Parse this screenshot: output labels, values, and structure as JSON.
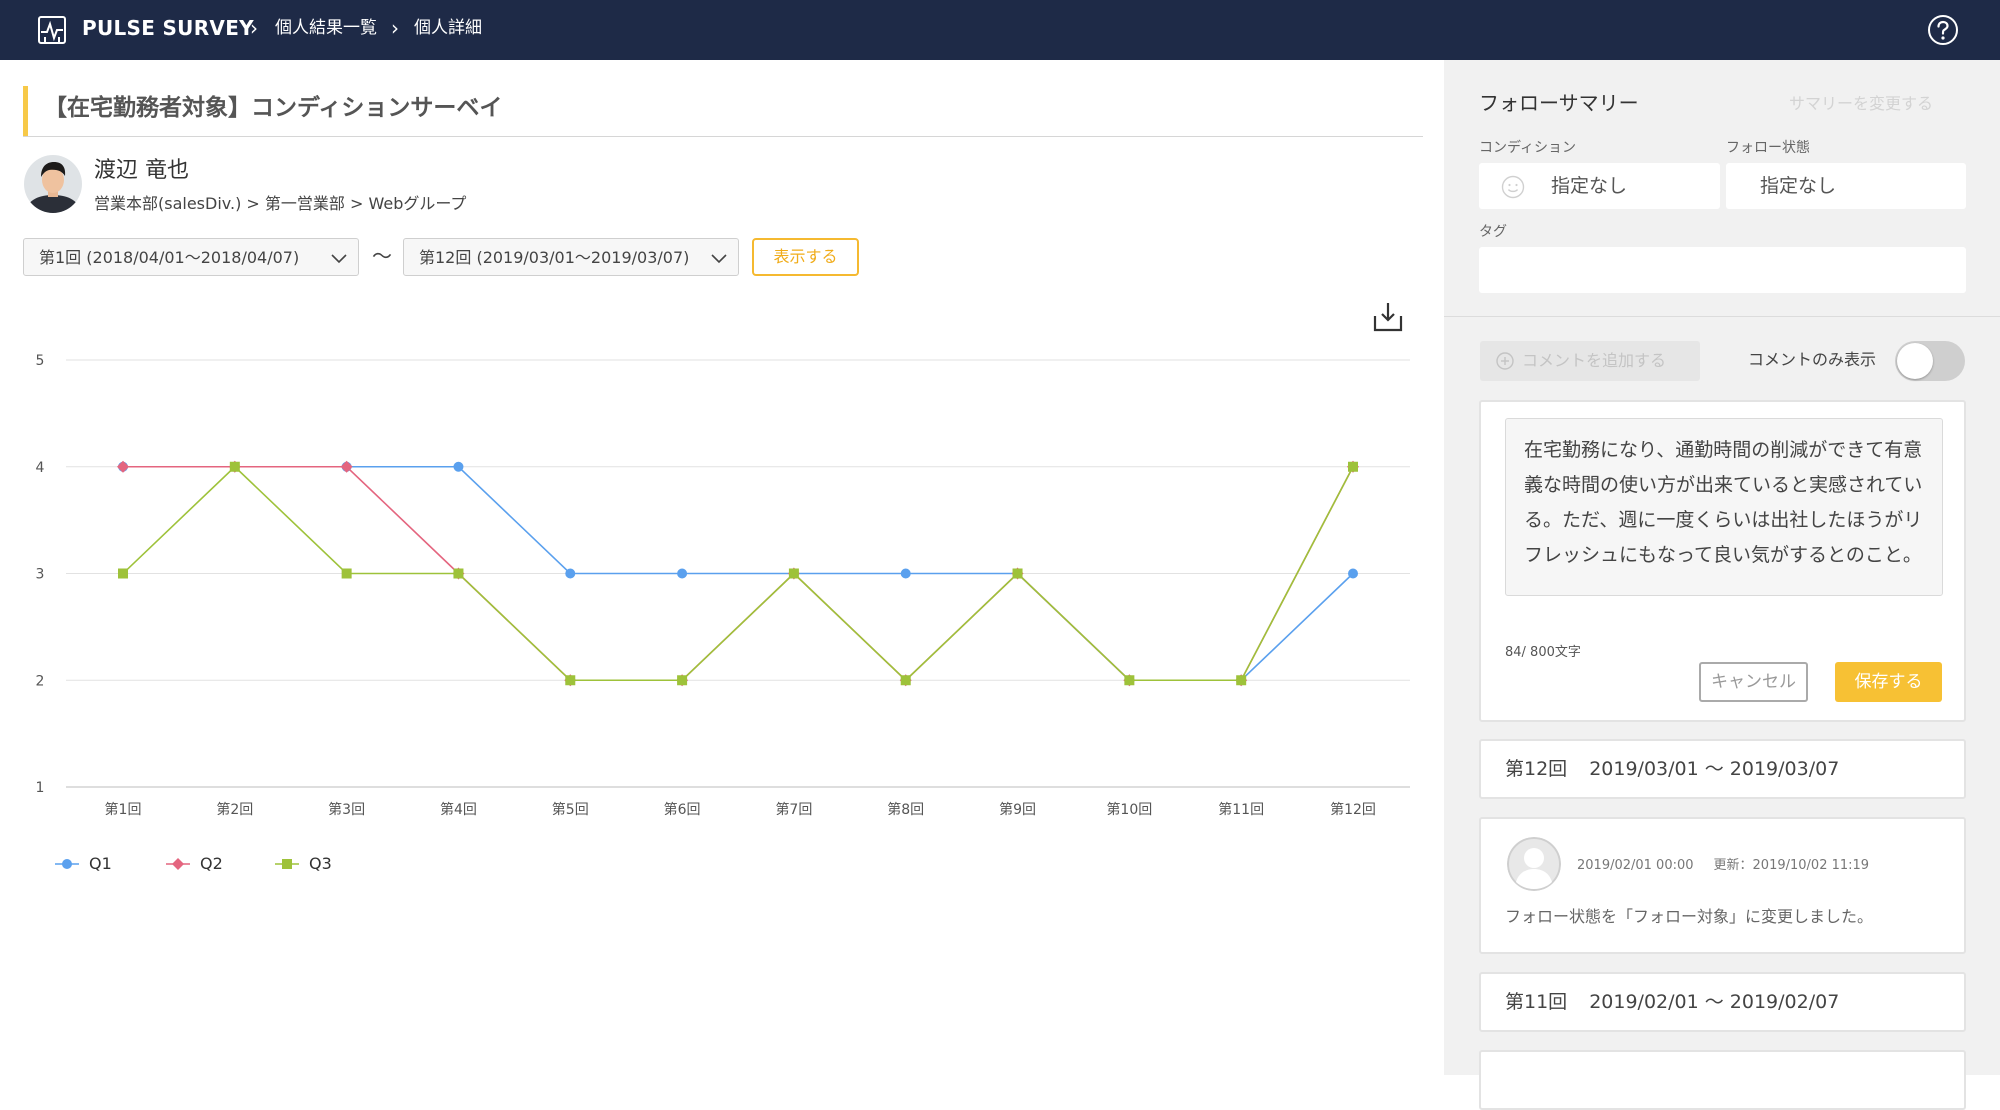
{
  "header": {
    "brand": "PULSE SURVEY",
    "breadcrumbs": [
      "個人結果一覧",
      "個人詳細"
    ],
    "icons": {
      "logo": "pulse-chart-icon",
      "help": "question-circle-icon"
    }
  },
  "survey": {
    "title": "【在宅勤務者対象】コンディションサーベイ"
  },
  "user": {
    "name": "渡辺 竜也",
    "department": "営業本部(salesDiv.) > 第一営業部 > Webグループ"
  },
  "filters": {
    "from_value": "第1回 (2018/04/01～2018/04/07)",
    "separator": "～",
    "to_value": "第12回 (2019/03/01～2019/03/07)",
    "show_button": "表示する"
  },
  "chart_data": {
    "type": "line",
    "categories": [
      "第1回",
      "第2回",
      "第3回",
      "第4回",
      "第5回",
      "第6回",
      "第7回",
      "第8回",
      "第9回",
      "第10回",
      "第11回",
      "第12回"
    ],
    "ylim": [
      1,
      5
    ],
    "yticks": [
      "1",
      "2",
      "3",
      "4",
      "5"
    ],
    "grid": true,
    "legend": "bottom-left",
    "series": [
      {
        "name": "Q1",
        "color": "#5aa0ee",
        "marker": "circle",
        "values": [
          4,
          4,
          4,
          4,
          3,
          3,
          3,
          3,
          3,
          2,
          2,
          3
        ]
      },
      {
        "name": "Q2",
        "color": "#e4657f",
        "marker": "diamond",
        "values": [
          4,
          4,
          4,
          3,
          2,
          2,
          3,
          2,
          3,
          2,
          2,
          4
        ]
      },
      {
        "name": "Q3",
        "color": "#9ec23a",
        "marker": "square",
        "values": [
          3,
          4,
          3,
          3,
          2,
          2,
          3,
          2,
          3,
          2,
          2,
          4
        ]
      }
    ]
  },
  "summary": {
    "title": "フォローサマリー",
    "change_link": "サマリーを変更する",
    "condition_label": "コンディション",
    "condition_value": "指定なし",
    "follow_label": "フォロー状態",
    "follow_value": "指定なし",
    "tag_label": "タグ",
    "tag_value": ""
  },
  "comments": {
    "add_button": "コメントを追加する",
    "only_label": "コメントのみ表示",
    "toggle_on": false,
    "draft_text": "在宅勤務になり、通勤時間の削減ができて有意義な時間の使い方が出来ていると実感されている。ただ、週に一度くらいは出社したほうがリフレッシュにもなって良い気がするとのこと。",
    "char_count": "84/ 800文字",
    "cancel": "キャンセル",
    "save": "保存する"
  },
  "history": [
    {
      "round": "第12回",
      "range": "2019/03/01 ～ 2019/03/07"
    },
    {
      "round": "第11回",
      "range": "2019/02/01 ～ 2019/02/07"
    }
  ],
  "log": {
    "created": "2019/02/01 00:00",
    "updated": "更新：2019/10/02 11:19",
    "text": "フォロー状態を「フォロー対象」に変更しました。"
  },
  "colors": {
    "header_bg": "#1e2a47",
    "accent": "#f7c948",
    "panel_bg": "#f1f1f1"
  }
}
